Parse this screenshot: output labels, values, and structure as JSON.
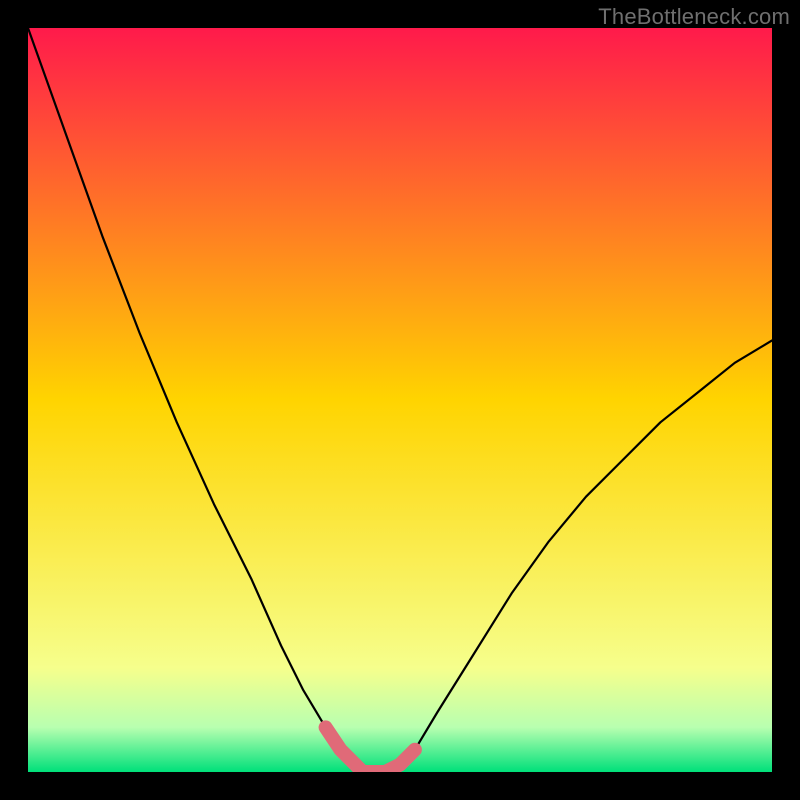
{
  "watermark": "TheBottleneck.com",
  "colors": {
    "bg": "#000000",
    "curve": "#000000",
    "highlight": "#e06a78",
    "gradient_top": "#ff1a4b",
    "gradient_mid": "#ffd400",
    "gradient_low1": "#f6ff8c",
    "gradient_low2": "#b8ffb0",
    "gradient_bottom": "#00e07a"
  },
  "chart_data": {
    "type": "line",
    "title": "",
    "xlabel": "",
    "ylabel": "",
    "xlim": [
      0,
      100
    ],
    "ylim": [
      0,
      100
    ],
    "x": [
      0,
      5,
      10,
      15,
      20,
      25,
      30,
      34,
      37,
      40,
      42,
      44,
      45,
      46,
      48,
      50,
      52,
      55,
      60,
      65,
      70,
      75,
      80,
      85,
      90,
      95,
      100
    ],
    "values": [
      100,
      86,
      72,
      59,
      47,
      36,
      26,
      17,
      11,
      6,
      3,
      1,
      0,
      0,
      0,
      1,
      3,
      8,
      16,
      24,
      31,
      37,
      42,
      47,
      51,
      55,
      58
    ],
    "highlight_range_x": [
      40,
      53
    ],
    "annotations": []
  }
}
